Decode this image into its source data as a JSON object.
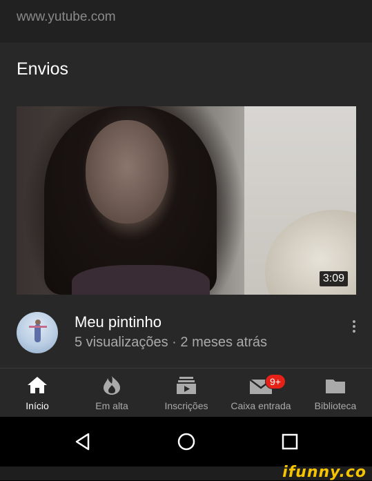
{
  "browser": {
    "url": "www.yutube.com"
  },
  "section": {
    "title": "Envios"
  },
  "video": {
    "duration": "3:09",
    "title": "Meu pintinho",
    "meta": "5 visualizações · 2 meses atrás"
  },
  "bottom_nav": {
    "tabs": [
      {
        "label": "Início",
        "icon": "home-icon",
        "active": true
      },
      {
        "label": "Em alta",
        "icon": "trending-flame-icon",
        "active": false
      },
      {
        "label": "Inscrições",
        "icon": "subscriptions-icon",
        "active": false
      },
      {
        "label": "Caixa entrada",
        "icon": "inbox-mail-icon",
        "active": false,
        "badge": "9+"
      },
      {
        "label": "Biblioteca",
        "icon": "library-folder-icon",
        "active": false
      }
    ]
  },
  "system_nav": {
    "buttons": [
      "back-icon",
      "home-circle-icon",
      "recents-square-icon"
    ]
  },
  "watermark": {
    "text": "ifunny.co"
  },
  "colors": {
    "badge": "#e62117",
    "watermark": "#f5c400",
    "background": "#282828"
  }
}
